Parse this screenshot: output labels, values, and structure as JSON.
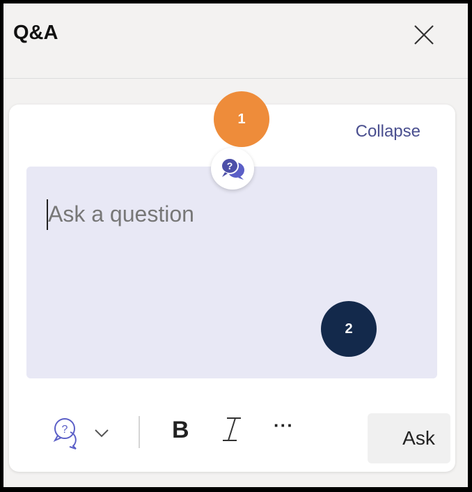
{
  "panel": {
    "title": "Q&A",
    "close_icon": "close-icon"
  },
  "composer": {
    "collapse_label": "Collapse",
    "placeholder": "Ask a question",
    "qa_icon": "qa-bubble-icon",
    "accent_color": "#5b5fc7",
    "input_bg": "#e8e8f5"
  },
  "toolbar": {
    "qa_type_icon": "question-bubble-icon",
    "bold_label": "B",
    "italic_icon": "italic-icon",
    "more_label": "···",
    "ask_label": "Ask"
  },
  "annotations": {
    "badge1": "1",
    "badge2": "2",
    "badge1_color": "#ee8c3a",
    "badge2_color": "#13294b"
  }
}
